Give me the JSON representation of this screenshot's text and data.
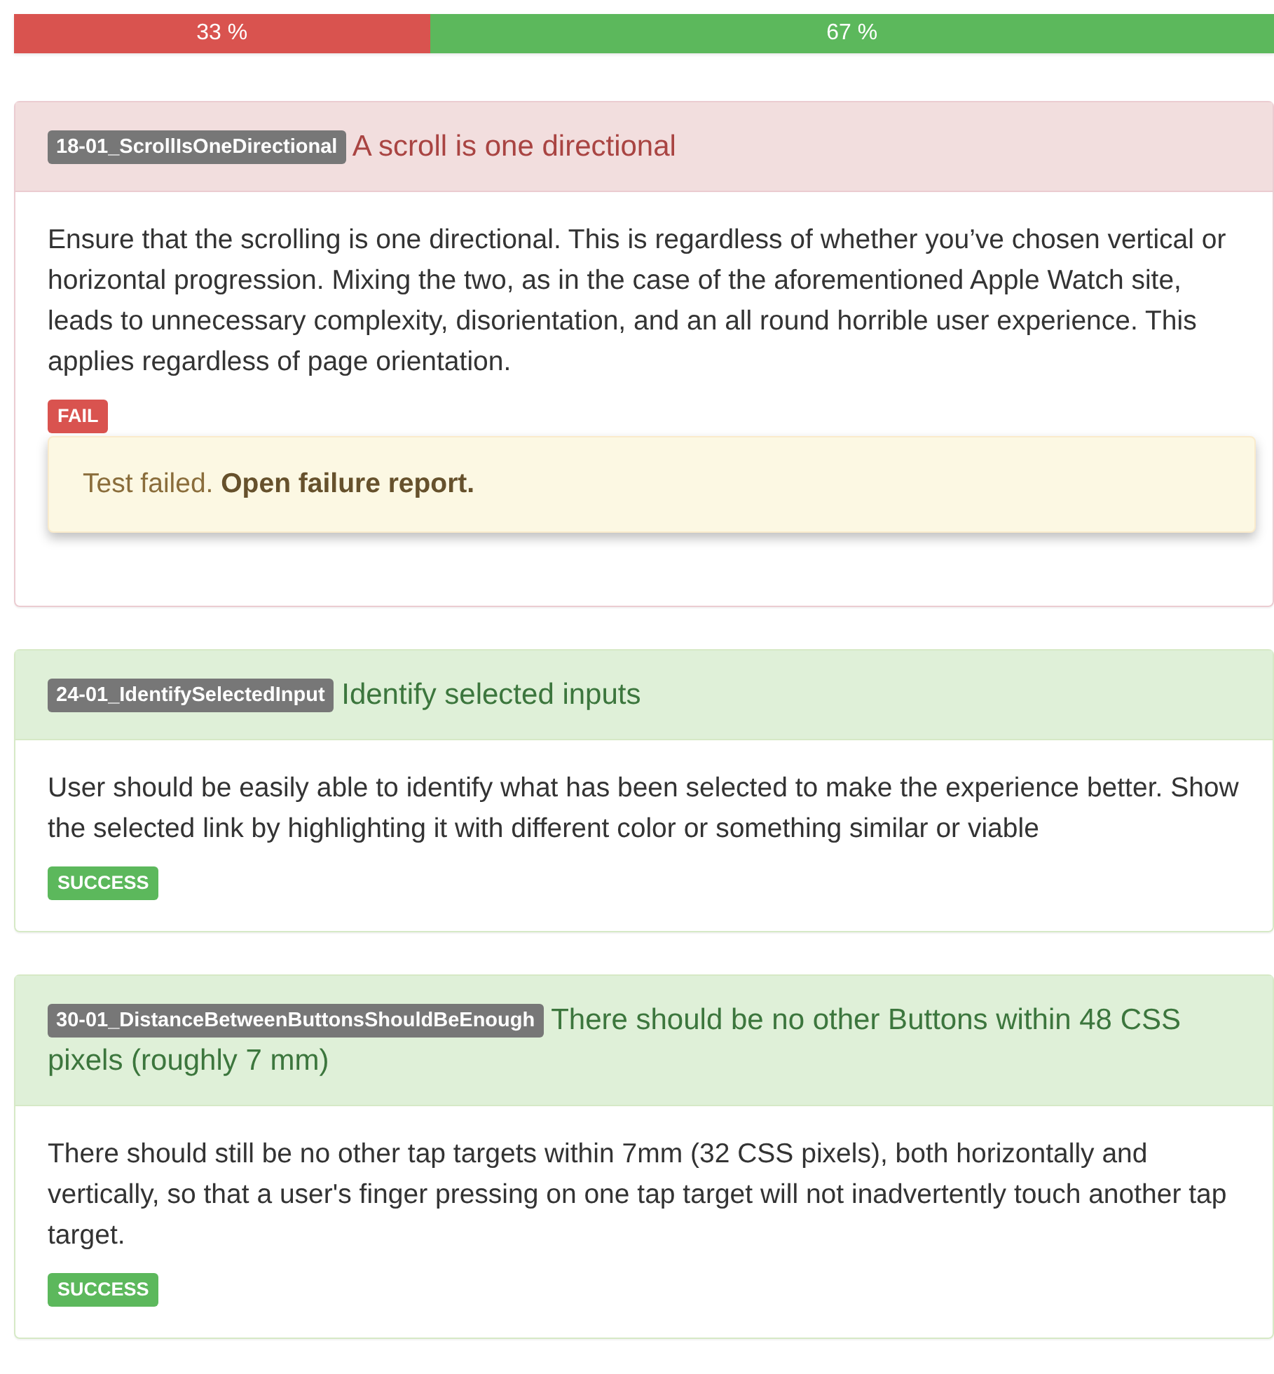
{
  "progress": [
    {
      "label": "33 %",
      "level": 0.33,
      "kind": "fail"
    },
    {
      "label": "67 %",
      "level": 0.67,
      "kind": "success"
    }
  ],
  "tests": [
    {
      "id": "18-01_ScrollIsOneDirectional",
      "title": "A scroll is one directional",
      "kind": "fail",
      "description": "Ensure that the scrolling is one directional. This is regardless of whether you’ve chosen vertical or horizontal progression. Mixing the two, as in the case of the aforementioned Apple Watch site, leads to unnecessary complexity, disorientation, and an all round horrible user experience. This applies regardless of page orientation.",
      "status_label": "FAIL",
      "report": "Test failed. **Open failure report.**"
    },
    {
      "id": "24-01_IdentifySelectedInput",
      "title": "Identify selected inputs",
      "kind": "success",
      "description": "User should be easily able to identify what has been selected to make the experience better. Show the selected link by highlighting it with different color or something similar or viable",
      "status_label": "SUCCESS"
    },
    {
      "id": "30-01_DistanceBetweenButtonsShouldBeEnough",
      "title": "There should be no other Buttons within 48 CSS pixels (roughly 7 mm)",
      "kind": "success",
      "description": "There should still be no other tap targets within 7mm (32 CSS pixels), both horizontally and vertically, so that a user's finger pressing on one tap target will not inadvertently touch another tap target.",
      "status_label": "SUCCESS"
    }
  ]
}
